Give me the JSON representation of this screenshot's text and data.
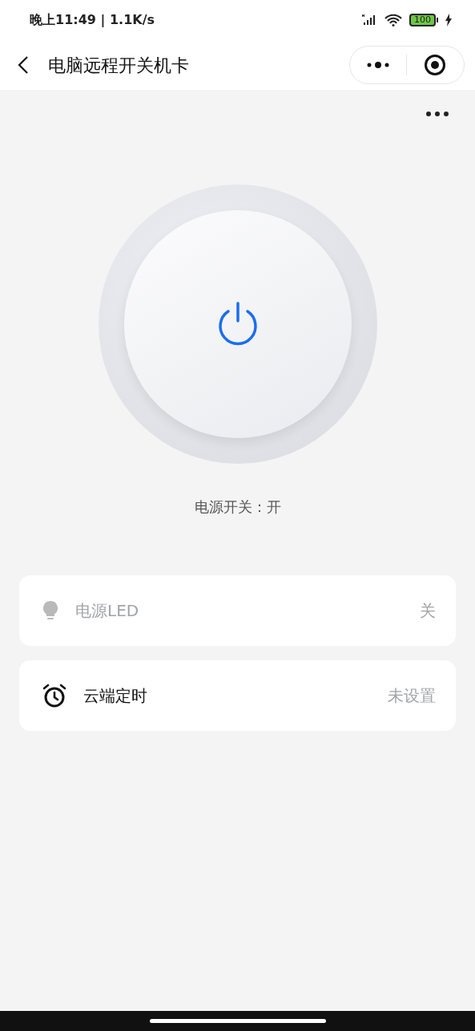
{
  "status_bar": {
    "time": "晚上11:49 | 1.1K/s",
    "battery": "100"
  },
  "nav_bar": {
    "title": "电脑远程开关机卡"
  },
  "power": {
    "on": true,
    "label": "电源开关：开"
  },
  "items": [
    {
      "kind": "led",
      "label": "电源LED",
      "value": "关",
      "dimmed": true
    },
    {
      "kind": "timer",
      "label": "云端定时",
      "value": "未设置",
      "dimmed": false
    }
  ]
}
